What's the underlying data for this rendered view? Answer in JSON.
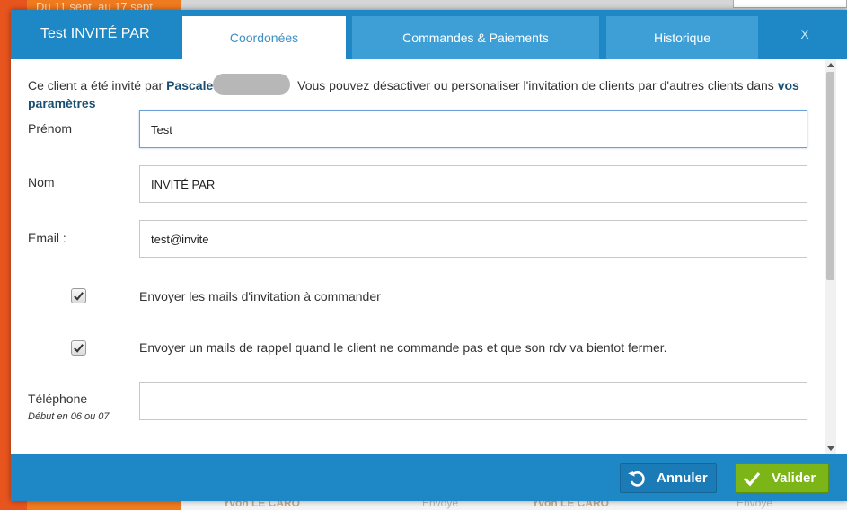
{
  "background": {
    "top_text": "Du 11 sept. au 17 sept.",
    "bottom_items": [
      "Yvon LE CARO",
      "Envoyé",
      "Yvon LE CARO",
      "Envoyé"
    ]
  },
  "modal": {
    "title": "Test INVITÉ PAR",
    "tabs": [
      {
        "label": "Coordonées",
        "active": true
      },
      {
        "label": "Commandes & Paiements",
        "active": false
      },
      {
        "label": "Historique",
        "active": false
      }
    ],
    "close_label": "X",
    "info": {
      "prefix": "Ce client a été invité par ",
      "inviter": "Pascale",
      "middle": " Vous pouvez désactiver ou personaliser l'invitation de clients par d'autres clients dans ",
      "settings_link": "vos paramètres"
    },
    "fields": {
      "prenom": {
        "label": "Prénom",
        "value": "Test"
      },
      "nom": {
        "label": "Nom",
        "value": "INVITÉ PAR"
      },
      "email": {
        "label": "Email :",
        "value": "test@invite"
      },
      "telephone": {
        "label": "Téléphone",
        "hint": "Début en 06 ou 07",
        "value": ""
      }
    },
    "checkboxes": [
      {
        "label": "Envoyer les mails d'invitation à commander",
        "checked": true
      },
      {
        "label": "Envoyer un mails de rappel quand le client ne commande pas et que son rdv va bientot fermer.",
        "checked": true
      }
    ],
    "footer": {
      "cancel_label": "Annuler",
      "validate_label": "Valider"
    }
  },
  "colors": {
    "header_blue": "#1e88c7",
    "tab_blue": "#3d9fd6",
    "validate_green": "#7cb518",
    "accent_orange": "#f07a1e"
  }
}
